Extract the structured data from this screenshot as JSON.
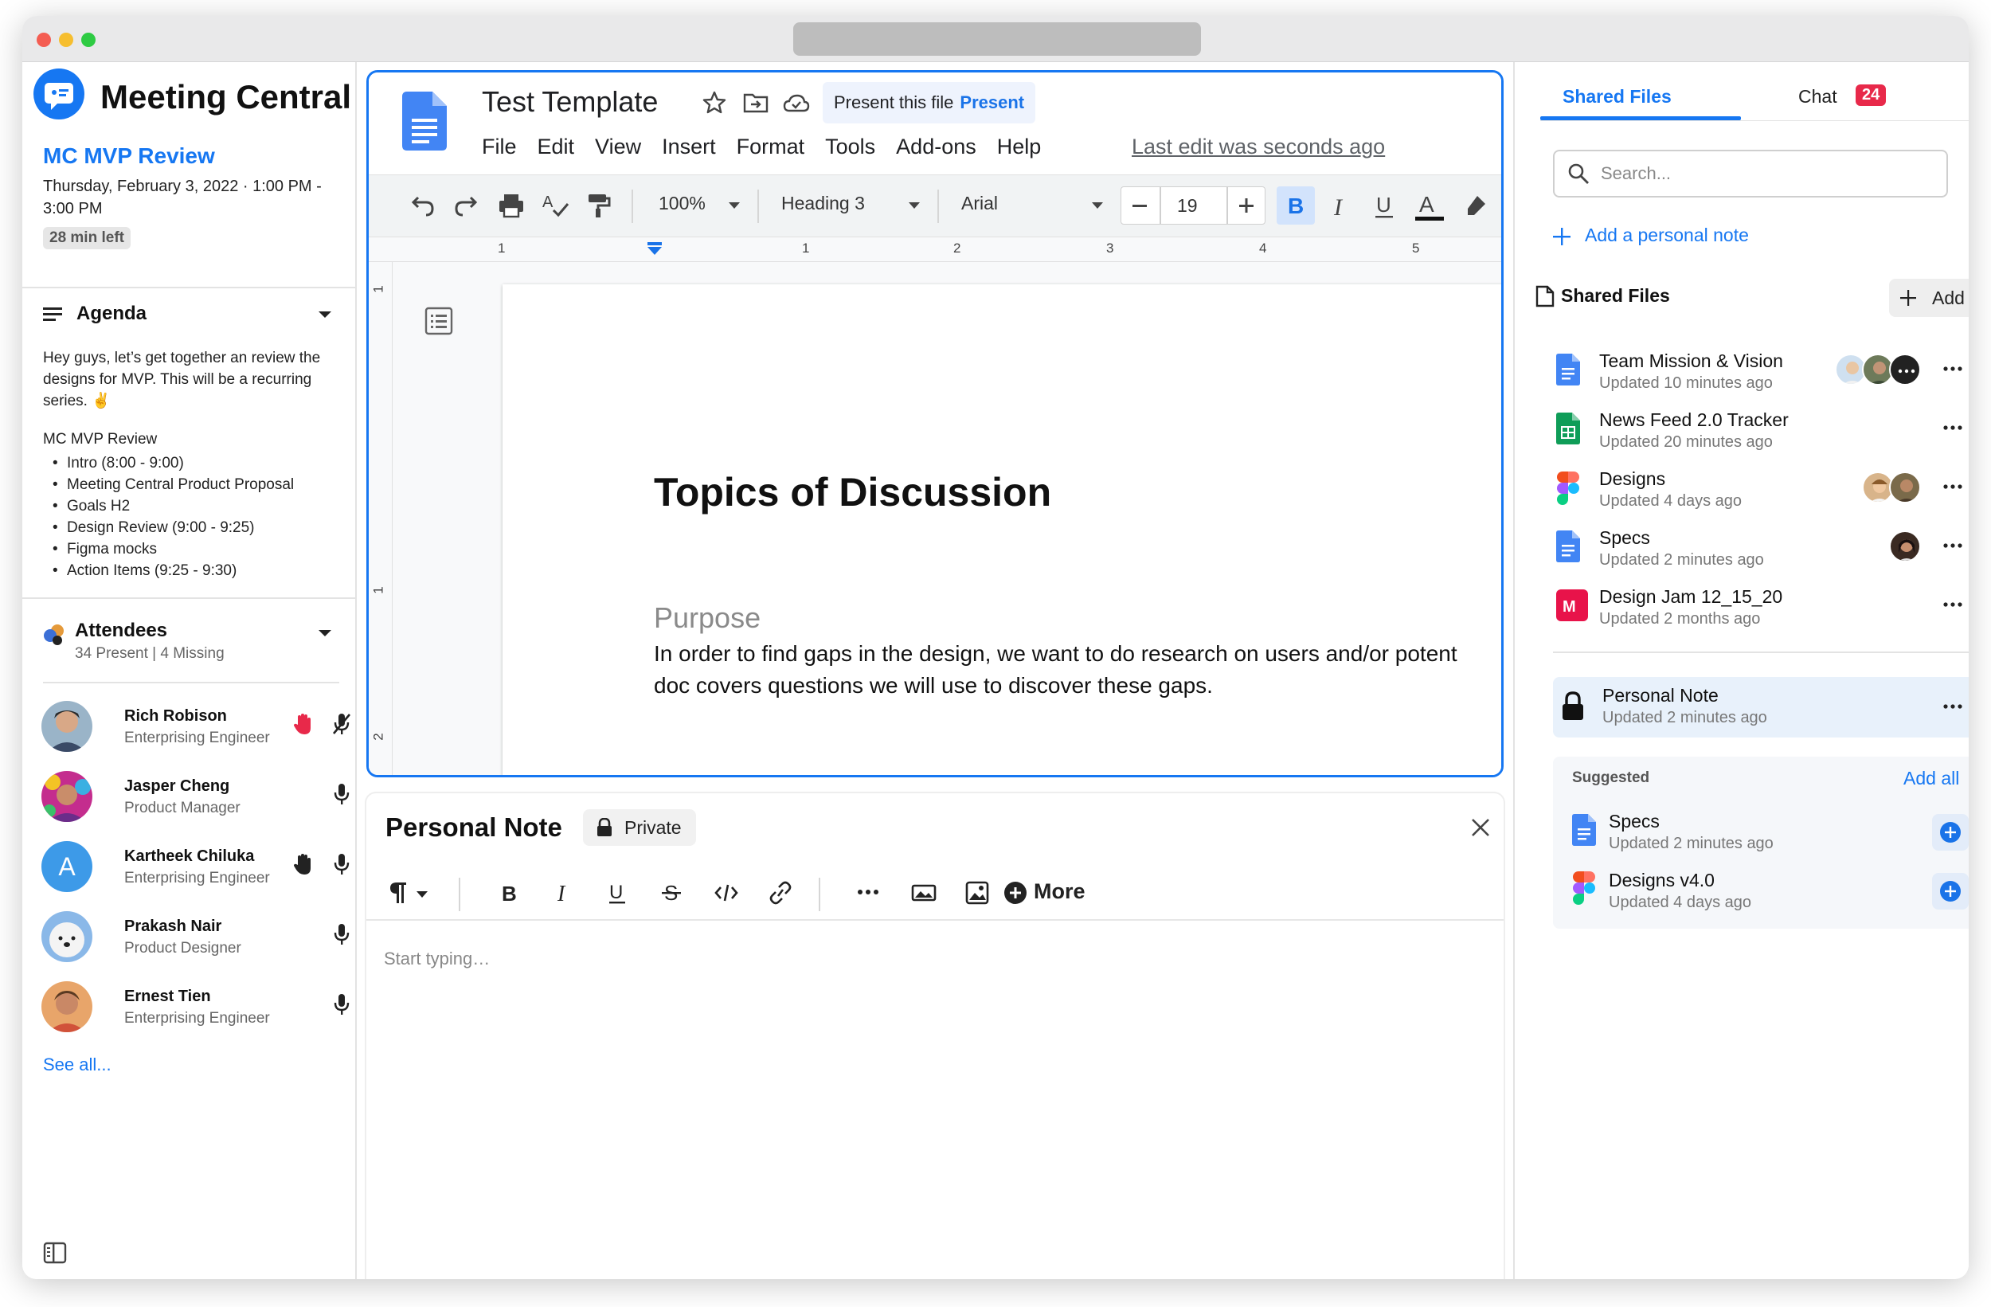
{
  "app": {
    "brand": "Meeting Central"
  },
  "meeting": {
    "title": "MC MVP Review",
    "time": "Thursday, February 3, 2022 · 1:00 PM - 3:00 PM",
    "remaining": "28 min left"
  },
  "agenda": {
    "heading": "Agenda",
    "text": "Hey guys, let’s get together an review the designs for MVP. This will be a recurring series. ✌",
    "list_title": "MC MVP Review",
    "items": [
      "Intro (8:00 - 9:00)",
      "Meeting Central Product Proposal",
      "Goals H2",
      "Design Review (9:00 - 9:25)",
      "Figma mocks",
      "Action Items (9:25 - 9:30)"
    ]
  },
  "attendees": {
    "heading": "Attendees",
    "summary": "34 Present | 4 Missing",
    "people": [
      {
        "name": "Rich Robison",
        "role": "Enterprising Engineer",
        "hand": "raised-red",
        "mic": "muted"
      },
      {
        "name": "Jasper Cheng",
        "role": "Product Manager",
        "hand": "",
        "mic": "on"
      },
      {
        "name": "Kartheek Chiluka",
        "role": "Enterprising Engineer",
        "hand": "raised",
        "mic": "on",
        "initial": "A"
      },
      {
        "name": "Prakash Nair",
        "role": "Product Designer",
        "hand": "",
        "mic": "on"
      },
      {
        "name": "Ernest Tien",
        "role": "Enterprising Engineer",
        "hand": "",
        "mic": "on"
      }
    ],
    "see_all": "See all..."
  },
  "doc": {
    "title": "Test Template",
    "menu": [
      "File",
      "Edit",
      "View",
      "Insert",
      "Format",
      "Tools",
      "Add-ons",
      "Help"
    ],
    "last_edit": "Last edit was seconds ago",
    "tooltip_text": "Present this file",
    "tooltip_action": "Present",
    "toolbar": {
      "zoom": "100%",
      "style": "Heading 3",
      "font": "Arial",
      "font_size": "19"
    },
    "ruler_numbers": [
      "1",
      "1",
      "2",
      "3",
      "4",
      "5"
    ],
    "vruler_numbers": [
      "1",
      "1",
      "2"
    ],
    "heading": "Topics of Discussion",
    "subheading": "Purpose",
    "body": "In order to find gaps in the design, we want to do research on users and/or potent",
    "body2": "doc covers questions we will use to discover these gaps."
  },
  "note": {
    "title": "Personal Note",
    "badge": "Private",
    "more": "More",
    "placeholder": "Start typing…"
  },
  "right": {
    "tab_files": "Shared Files",
    "tab_chat": "Chat",
    "chat_count": "24",
    "search_placeholder": "Search...",
    "add_note": "Add a personal note",
    "files_heading": "Shared Files",
    "add_label": "Add",
    "files": [
      {
        "name": "Team Mission & Vision",
        "updated": "Updated 10 minutes ago",
        "icon": "google-docs-icon"
      },
      {
        "name": "News Feed 2.0 Tracker",
        "updated": "Updated 20 minutes ago",
        "icon": "google-sheets-icon"
      },
      {
        "name": "Designs",
        "updated": "Updated 4 days ago",
        "icon": "figma-icon"
      },
      {
        "name": "Specs",
        "updated": "Updated 2 minutes ago",
        "icon": "google-docs-icon"
      },
      {
        "name": "Design Jam 12_15_20",
        "updated": "Updated 2 months ago",
        "icon": "miro-icon"
      }
    ],
    "personal_note": {
      "name": "Personal Note",
      "updated": "Updated 2 minutes ago"
    },
    "suggested_heading": "Suggested",
    "add_all": "Add all",
    "suggested": [
      {
        "name": "Specs",
        "updated": "Updated 2 minutes ago"
      },
      {
        "name": "Designs v4.0",
        "updated": "Updated 4 days ago"
      }
    ]
  },
  "colors": {
    "accent": "#1677f2",
    "badge": "#e8294a",
    "docs_blue": "#4285f4",
    "sheets_green": "#0f9d58"
  }
}
